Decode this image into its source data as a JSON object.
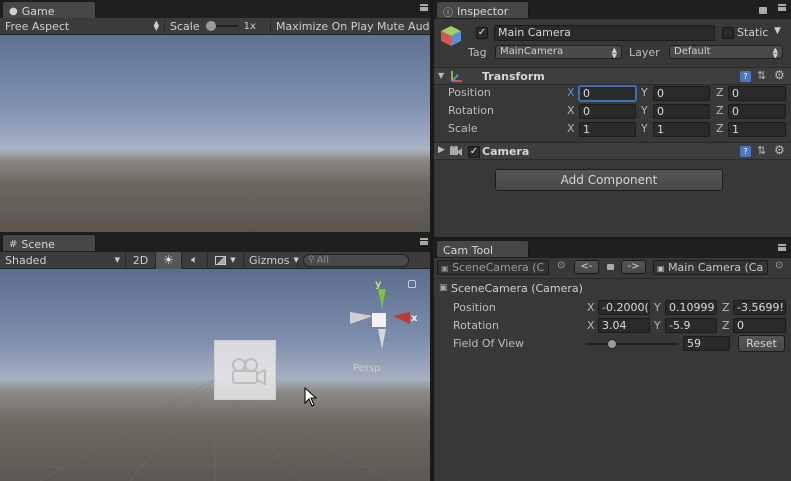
{
  "game": {
    "tab_label": "Game",
    "aspect": "Free Aspect",
    "scale_label": "Scale",
    "scale_value": "1x",
    "maximize_label": "Maximize On Play",
    "mute_label": "Mute Audi"
  },
  "scene": {
    "tab_label": "Scene",
    "shading_mode": "Shaded",
    "mode_2d": "2D",
    "gizmos_label": "Gizmos",
    "search_placeholder": "All",
    "gizmo": {
      "y": "y",
      "x": "x",
      "persp": "Persp"
    }
  },
  "inspector": {
    "tab_label": "Inspector",
    "object_name": "Main Camera",
    "static_label": "Static",
    "tag_label": "Tag",
    "tag_value": "MainCamera",
    "layer_label": "Layer",
    "layer_value": "Default",
    "transform": {
      "title": "Transform",
      "rows": [
        {
          "label": "Position",
          "x": "0",
          "y": "0",
          "z": "0"
        },
        {
          "label": "Rotation",
          "x": "0",
          "y": "0",
          "z": "0"
        },
        {
          "label": "Scale",
          "x": "1",
          "y": "1",
          "z": "1"
        }
      ]
    },
    "camera_title": "Camera",
    "add_component": "Add Component"
  },
  "cam_tool": {
    "tab_label": "Cam Tool",
    "source_camera": "SceneCamera (C",
    "prev_label": "<-",
    "next_label": "->",
    "target_camera": "Main Camera (Ca",
    "header": "SceneCamera (Camera)",
    "position_label": "Position",
    "position": {
      "x": "-0.2000(",
      "y": "0.10999",
      "z": "-3.5699!"
    },
    "rotation_label": "Rotation",
    "rotation": {
      "x": "3.04",
      "y": "-5.9",
      "z": "0"
    },
    "fov_label": "Field Of View",
    "fov_value": "59",
    "fov_fraction": 0.25,
    "reset_label": "Reset"
  },
  "axis_labels": {
    "x": "X",
    "y": "Y",
    "z": "Z"
  },
  "colors": {
    "accent_blue": "#3d6fb6",
    "gizmo_y": "#7bc043",
    "gizmo_x": "#c0392b"
  }
}
